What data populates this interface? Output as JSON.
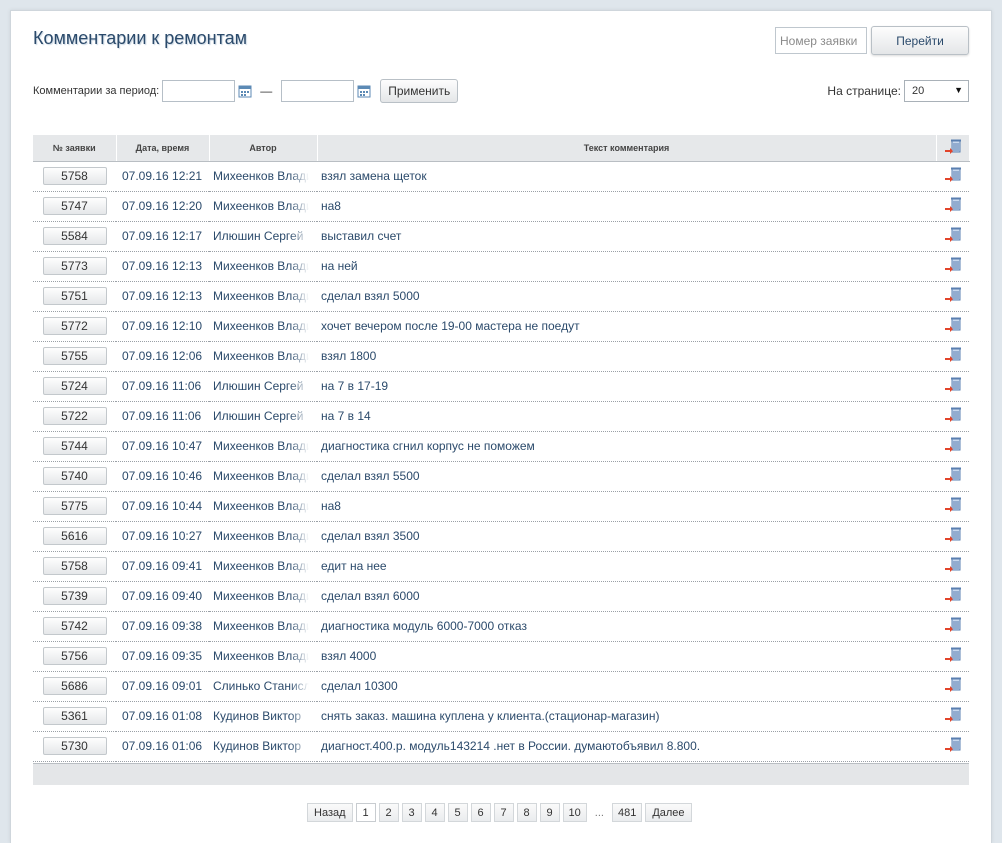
{
  "header": {
    "title": "Комментарии к ремонтам",
    "order_placeholder": "Номер заявки",
    "go_label": "Перейти"
  },
  "filter": {
    "period_label": "Комментарии за период:",
    "date_from": "",
    "date_to": "",
    "dash": "—",
    "apply_label": "Применить",
    "per_page_label": "На странице:",
    "per_page_value": "20"
  },
  "table": {
    "columns": [
      "№ заявки",
      "Дата, время",
      "Автор",
      "Текст комментария"
    ],
    "rows": [
      {
        "num": "5758",
        "date": "07.09.16 12:21",
        "author": "Михеенков Владимир",
        "text": "взял замена щеток"
      },
      {
        "num": "5747",
        "date": "07.09.16 12:20",
        "author": "Михеенков Владимир",
        "text": "на8"
      },
      {
        "num": "5584",
        "date": "07.09.16 12:17",
        "author": "Илюшин Сергей",
        "text": "выставил счет"
      },
      {
        "num": "5773",
        "date": "07.09.16 12:13",
        "author": "Михеенков Владимир",
        "text": "на ней"
      },
      {
        "num": "5751",
        "date": "07.09.16 12:13",
        "author": "Михеенков Владимир",
        "text": "сделал взял 5000"
      },
      {
        "num": "5772",
        "date": "07.09.16 12:10",
        "author": "Михеенков Владимир",
        "text": "хочет вечером после 19-00 мастера не поедут"
      },
      {
        "num": "5755",
        "date": "07.09.16 12:06",
        "author": "Михеенков Владимир",
        "text": "взял 1800"
      },
      {
        "num": "5724",
        "date": "07.09.16 11:06",
        "author": "Илюшин Сергей",
        "text": "на 7 в 17-19"
      },
      {
        "num": "5722",
        "date": "07.09.16 11:06",
        "author": "Илюшин Сергей",
        "text": "на 7 в 14"
      },
      {
        "num": "5744",
        "date": "07.09.16 10:47",
        "author": "Михеенков Владимир",
        "text": "диагностика сгнил корпус не поможем"
      },
      {
        "num": "5740",
        "date": "07.09.16 10:46",
        "author": "Михеенков Владимир",
        "text": "сделал взял 5500"
      },
      {
        "num": "5775",
        "date": "07.09.16 10:44",
        "author": "Михеенков Владимир",
        "text": "на8"
      },
      {
        "num": "5616",
        "date": "07.09.16 10:27",
        "author": "Михеенков Владимир",
        "text": "сделал взял 3500"
      },
      {
        "num": "5758",
        "date": "07.09.16 09:41",
        "author": "Михеенков Владимир",
        "text": "едит на нее"
      },
      {
        "num": "5739",
        "date": "07.09.16 09:40",
        "author": "Михеенков Владимир",
        "text": "сделал взял 6000"
      },
      {
        "num": "5742",
        "date": "07.09.16 09:38",
        "author": "Михеенков Владимир",
        "text": "диагностика модуль 6000-7000 отказ"
      },
      {
        "num": "5756",
        "date": "07.09.16 09:35",
        "author": "Михеенков Владимир",
        "text": "взял 4000"
      },
      {
        "num": "5686",
        "date": "07.09.16 09:01",
        "author": "Слинько Станислав",
        "text": "сделал 10300"
      },
      {
        "num": "5361",
        "date": "07.09.16 01:08",
        "author": "Кудинов Виктор",
        "text": "снять заказ. машина куплена у клиента.(стационар-магазин)"
      },
      {
        "num": "5730",
        "date": "07.09.16 01:06",
        "author": "Кудинов Виктор",
        "text": "диагност.400.р. модуль143214 .нет в России. думаютобъявил 8.800."
      }
    ]
  },
  "pagination": {
    "prev_label": "Назад",
    "pages": [
      "1",
      "2",
      "3",
      "4",
      "5",
      "6",
      "7",
      "8",
      "9",
      "10"
    ],
    "current": "1",
    "ellipsis": "...",
    "last": "481",
    "next_label": "Далее"
  },
  "icons": {
    "calendar": "calendar-icon",
    "row_action": "delete-comment-icon",
    "header_action": "delete-all-icon"
  }
}
